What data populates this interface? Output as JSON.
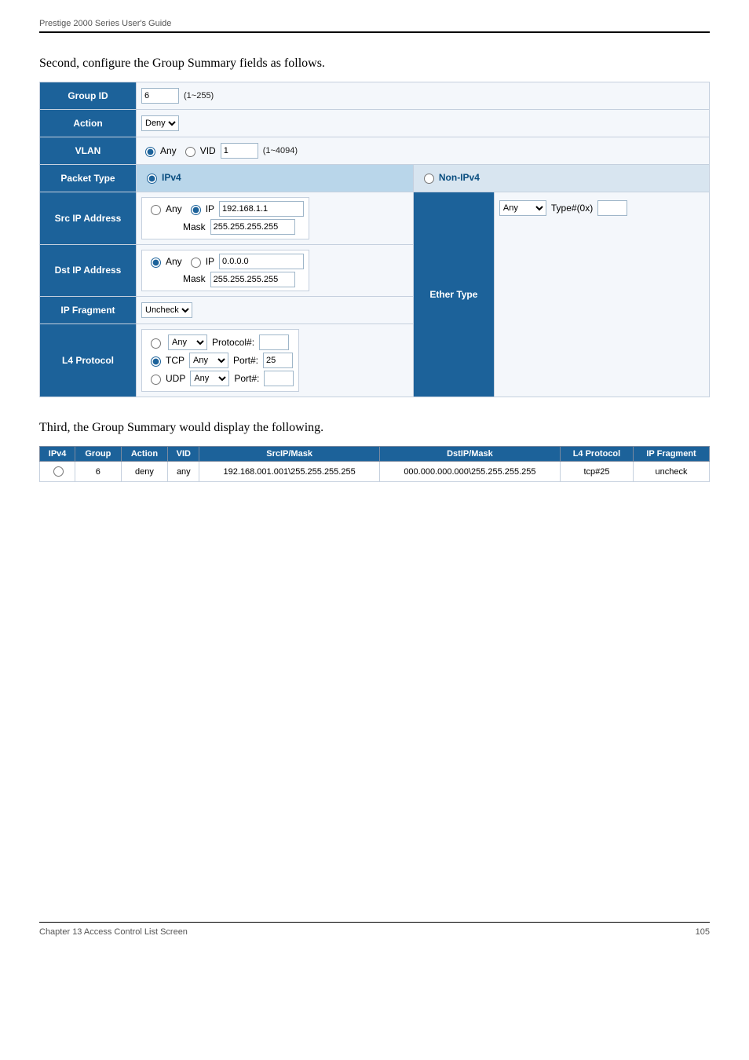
{
  "header": {
    "left": "Prestige 2000 Series User's Guide",
    "right": ""
  },
  "intro": "Second, configure the Group Summary fields as follows.",
  "labels": {
    "group_id": "Group ID",
    "action": "Action",
    "vlan": "VLAN",
    "packet_type": "Packet Type",
    "src_ip": "Src IP Address",
    "dst_ip": "Dst IP Address",
    "ip_fragment": "IP Fragment",
    "l4_protocol": "L4 Protocol",
    "ether_type": "Ether Type"
  },
  "fields": {
    "group_id_value": "6",
    "group_id_hint": "(1~255)",
    "action_value": "Deny",
    "vlan_any": "Any",
    "vlan_vid_label": "VID",
    "vlan_vid_value": "1",
    "vlan_hint": "(1~4094)",
    "ipv4_label": "IPv4",
    "nonipv4_label": "Non-IPv4",
    "src_any": "Any",
    "src_ip_label": "IP",
    "src_ip_value": "192.168.1.1",
    "src_mask_label": "Mask",
    "src_mask_value": "255.255.255.255",
    "dst_any": "Any",
    "dst_ip_label": "IP",
    "dst_ip_value": "0.0.0.0",
    "dst_mask_label": "Mask",
    "dst_mask_value": "255.255.255.255",
    "ip_fragment_value": "Uncheck",
    "l4_proto_any": "Any",
    "l4_proto_proto_label": "Protocol#:",
    "l4_tcp_label": "TCP",
    "l4_tcp_any": "Any",
    "l4_tcp_port_label": "Port#:",
    "l4_tcp_port_value": "25",
    "l4_udp_label": "UDP",
    "l4_udp_any": "Any",
    "l4_udp_port_label": "Port#:",
    "l4_udp_port_value": "",
    "ether_type_any": "Any",
    "ether_type_type_label": "Type#(0x)",
    "ether_type_type_value": ""
  },
  "intermediate": "Third, the Group Summary would display the following.",
  "summary": {
    "headers": {
      "ipv4": "IPv4",
      "group": "Group",
      "action": "Action",
      "vid": "VID",
      "srcip": "SrcIP/Mask",
      "dstip": "DstIP/Mask",
      "l4": "L4 Protocol",
      "ipfrag": "IP Fragment"
    },
    "row": {
      "group": "6",
      "action": "deny",
      "vid": "any",
      "srcip": "192.168.001.001\\255.255.255.255",
      "dstip": "000.000.000.000\\255.255.255.255",
      "l4": "tcp#25",
      "ipfrag": "uncheck"
    }
  },
  "footer": {
    "left": "Chapter 13 Access Control List Screen",
    "right": "105"
  }
}
